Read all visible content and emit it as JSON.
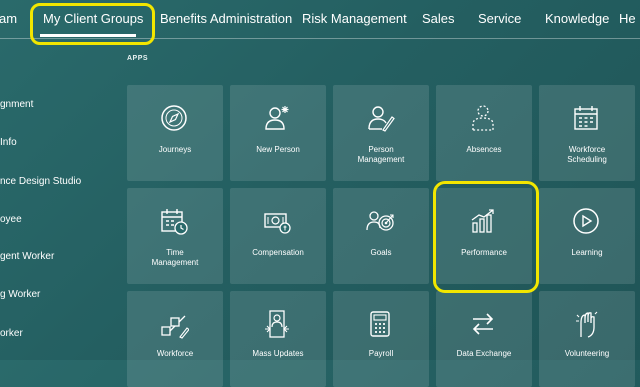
{
  "nav": {
    "items": [
      "am",
      "My Client Groups",
      "Benefits Administration",
      "Risk Management",
      "Sales",
      "Service",
      "Knowledge",
      "He"
    ]
  },
  "sidebar": {
    "items": [
      "gnment",
      "Info",
      "nce Design Studio",
      "oyee",
      "gent Worker",
      "g Worker",
      "orker"
    ]
  },
  "section": {
    "title": "APPS"
  },
  "tiles": [
    {
      "label": "Journeys",
      "icon": "compass-icon"
    },
    {
      "label": "New Person",
      "icon": "new-person-icon"
    },
    {
      "label": "Person\nManagement",
      "icon": "person-management-icon"
    },
    {
      "label": "Absences",
      "icon": "absences-icon"
    },
    {
      "label": "Workforce\nScheduling",
      "icon": "calendar-icon"
    },
    {
      "label": "Time\nManagement",
      "icon": "time-management-icon"
    },
    {
      "label": "Compensation",
      "icon": "compensation-icon"
    },
    {
      "label": "Goals",
      "icon": "goals-icon"
    },
    {
      "label": "Performance",
      "icon": "performance-icon"
    },
    {
      "label": "Learning",
      "icon": "play-icon"
    },
    {
      "label": "Workforce",
      "icon": "workforce-icon"
    },
    {
      "label": "Mass Updates",
      "icon": "mass-updates-icon"
    },
    {
      "label": "Payroll",
      "icon": "calculator-icon"
    },
    {
      "label": "Data Exchange",
      "icon": "data-exchange-icon"
    },
    {
      "label": "Volunteering",
      "icon": "volunteering-icon"
    }
  ],
  "colors": {
    "highlight": "#f2e600",
    "background": "#245f61",
    "tile": "rgba(255,255,255,0.12)"
  }
}
